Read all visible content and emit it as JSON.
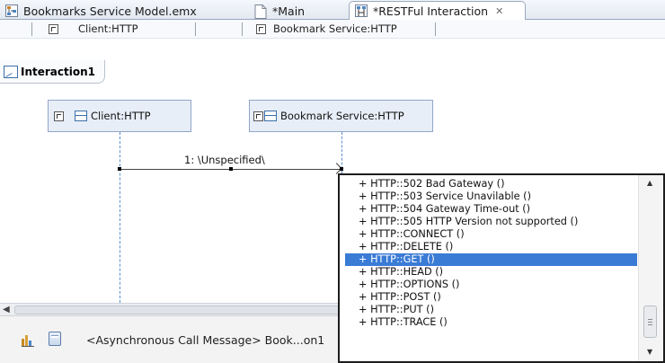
{
  "tabs": [
    {
      "label": "Bookmarks Service Model.emx",
      "icon": "model-icon"
    },
    {
      "label": "*Main",
      "icon": "document-icon"
    },
    {
      "label": "*RESTFul Interaction",
      "icon": "interaction-diagram-icon",
      "active": true,
      "close": "✕"
    }
  ],
  "lifeline_header": {
    "left": "Client:HTTP",
    "right": "Bookmark Service:HTTP"
  },
  "frame": {
    "label": "Interaction1"
  },
  "lifelines": [
    {
      "label": "Client:HTTP"
    },
    {
      "label": "Bookmark Service:HTTP"
    }
  ],
  "message": {
    "label": "1: \\Unspecified\\"
  },
  "statusbar": {
    "text": "<Asynchronous Call Message> Book...on1"
  },
  "scroll_arrows": {
    "left": "◀",
    "up": "▲",
    "down": "▼"
  },
  "proposals": [
    "HTTP::502 Bad Gateway ()",
    "HTTP::503 Service Unavilable ()",
    "HTTP::504 Gateway Time-out ()",
    "HTTP::505 HTTP Version not supported ()",
    "HTTP::CONNECT ()",
    "HTTP::DELETE ()",
    "HTTP::GET ()",
    "HTTP::HEAD ()",
    "HTTP::OPTIONS ()",
    "HTTP::POST ()",
    "HTTP::PUT ()",
    "HTTP::TRACE ()"
  ],
  "proposal_prefix": "+",
  "selected_index": 6,
  "colors": {
    "selection": "#3a7bd5",
    "lifeline_fill": "#e7eef8",
    "lifeline_border": "#8fa6c6"
  }
}
